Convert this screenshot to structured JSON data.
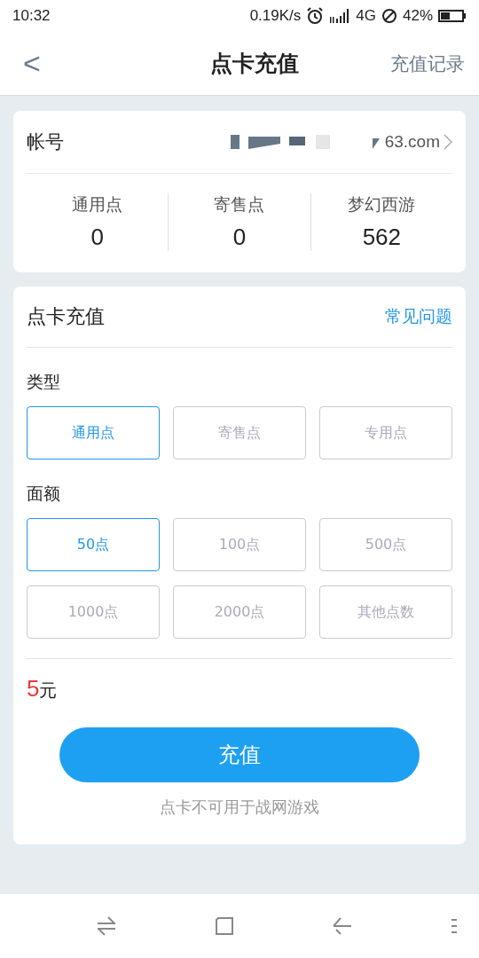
{
  "status_bar": {
    "time": "10:32",
    "speed": "0.19K/s",
    "network": "4G",
    "battery": "42%"
  },
  "header": {
    "back": "<",
    "title": "点卡充值",
    "action": "充值记录"
  },
  "account": {
    "label": "帐号",
    "value": "63.com"
  },
  "balances": [
    {
      "label": "通用点",
      "value": "0"
    },
    {
      "label": "寄售点",
      "value": "0"
    },
    {
      "label": "梦幻西游",
      "value": "562"
    }
  ],
  "recharge": {
    "title": "点卡充值",
    "faq": "常见问题",
    "type_label": "类型",
    "types": [
      {
        "label": "通用点",
        "selected": true
      },
      {
        "label": "寄售点",
        "selected": false
      },
      {
        "label": "专用点",
        "selected": false
      }
    ],
    "amount_label": "面额",
    "amounts": [
      {
        "label": "50点",
        "selected": true
      },
      {
        "label": "100点",
        "selected": false
      },
      {
        "label": "500点",
        "selected": false
      },
      {
        "label": "1000点",
        "selected": false
      },
      {
        "label": "2000点",
        "selected": false
      },
      {
        "label": "其他点数",
        "selected": false
      }
    ],
    "price_value": "5",
    "price_unit": "元",
    "button": "充值",
    "note": "点卡不可用于战网游戏"
  }
}
